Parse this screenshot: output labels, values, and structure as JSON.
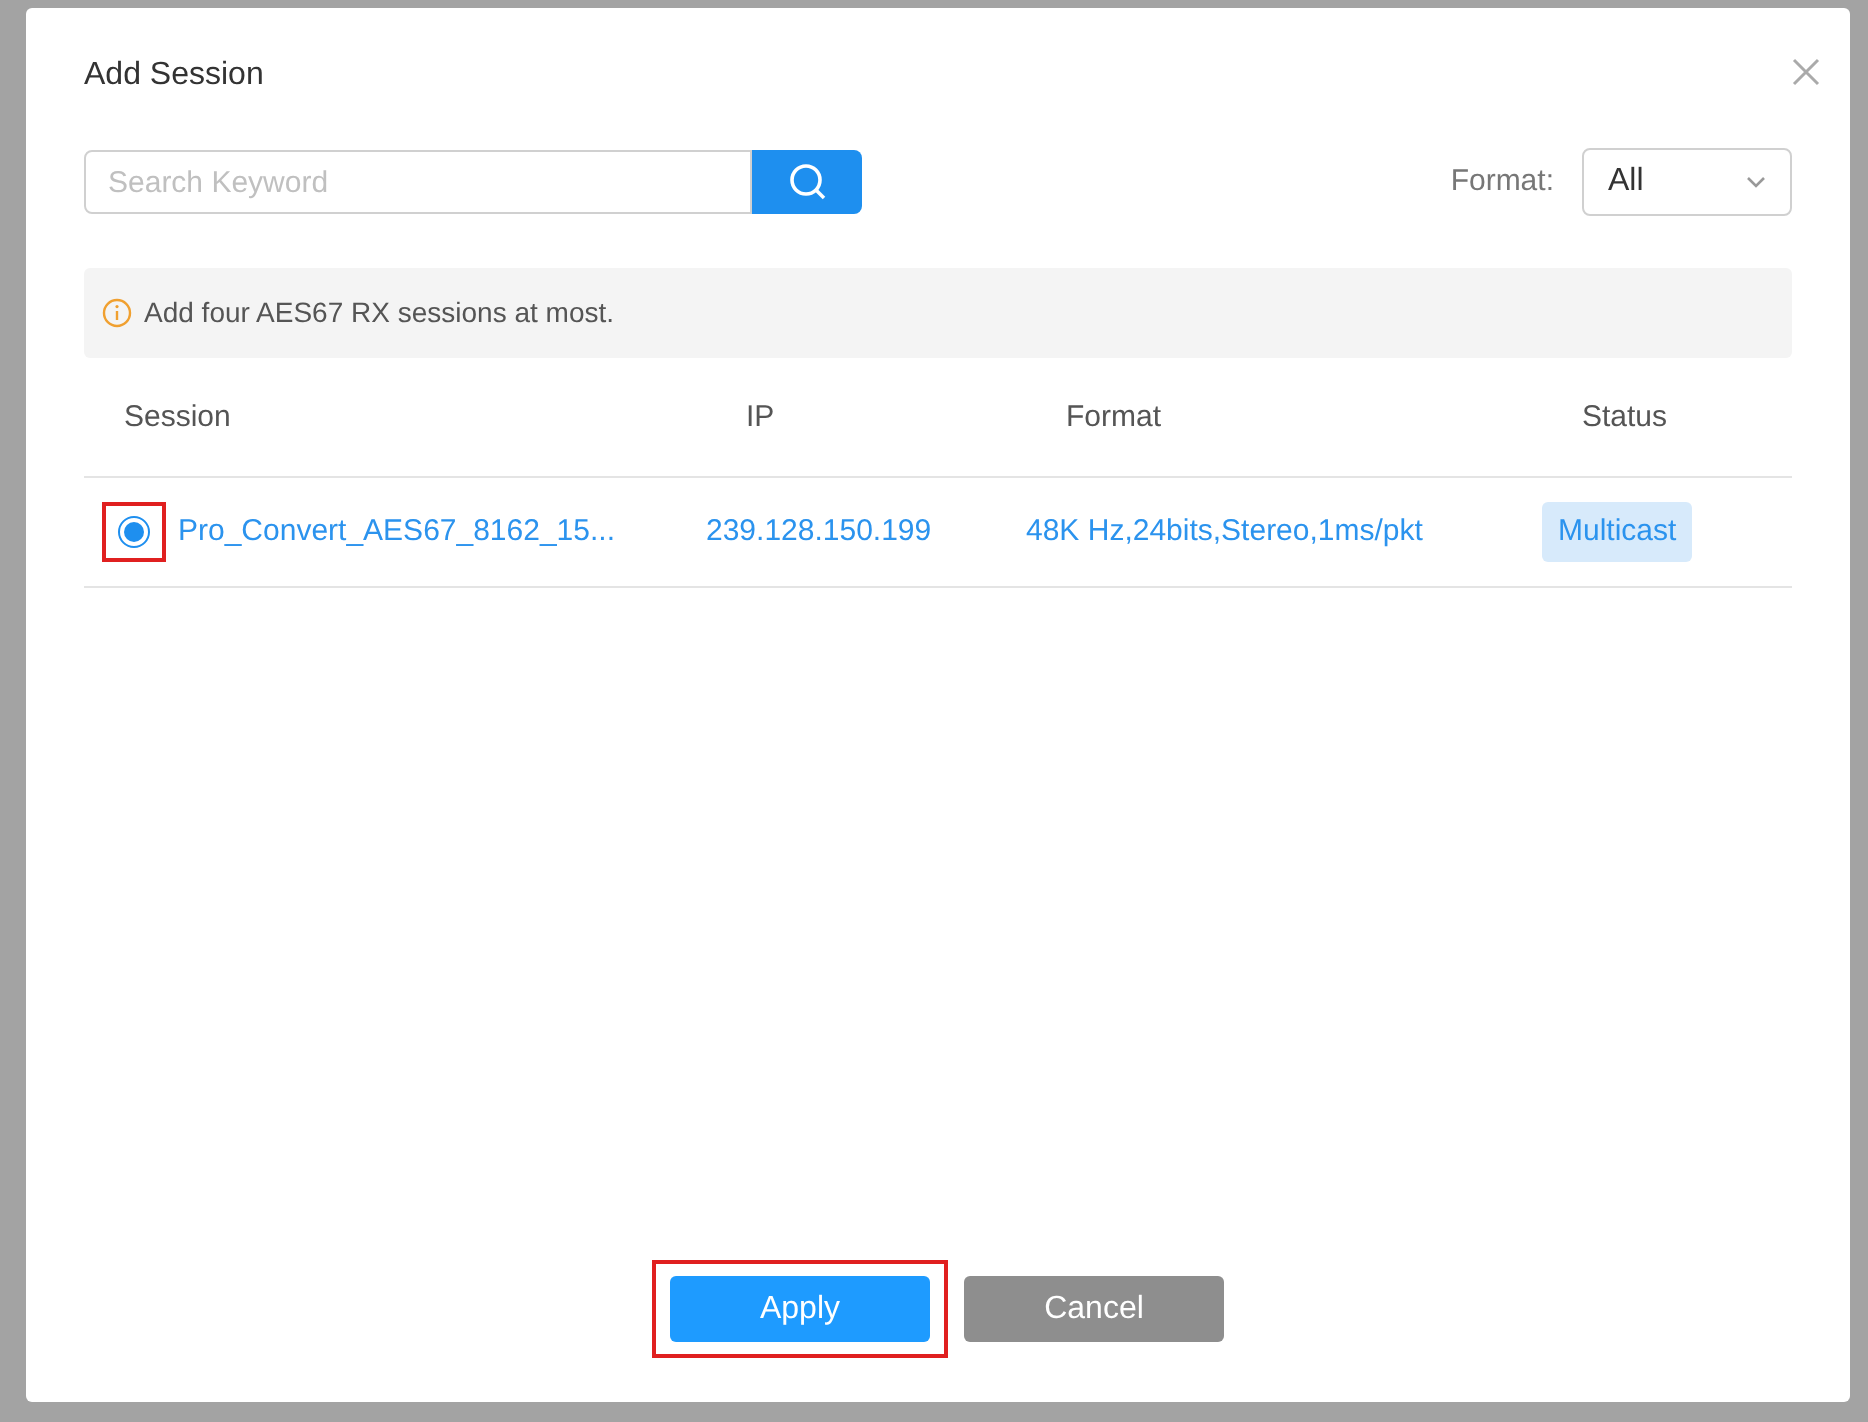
{
  "dialog": {
    "title": "Add Session"
  },
  "search": {
    "placeholder": "Search Keyword"
  },
  "format_filter": {
    "label": "Format:",
    "value": "All"
  },
  "notice": "Add four AES67 RX sessions at most.",
  "table": {
    "columns": [
      "Session",
      "IP",
      "Format",
      "Status"
    ],
    "rows": [
      {
        "selected": true,
        "highlighted": true,
        "session": "Pro_Convert_AES67_8162_15...",
        "ip": "239.128.150.199",
        "format": "48K Hz,24bits,Stereo,1ms/pkt",
        "status": "Multicast"
      }
    ]
  },
  "buttons": [
    {
      "label": "Apply",
      "kind": "primary",
      "highlighted": true
    },
    {
      "label": "Cancel",
      "kind": "secondary",
      "highlighted": false
    }
  ]
}
